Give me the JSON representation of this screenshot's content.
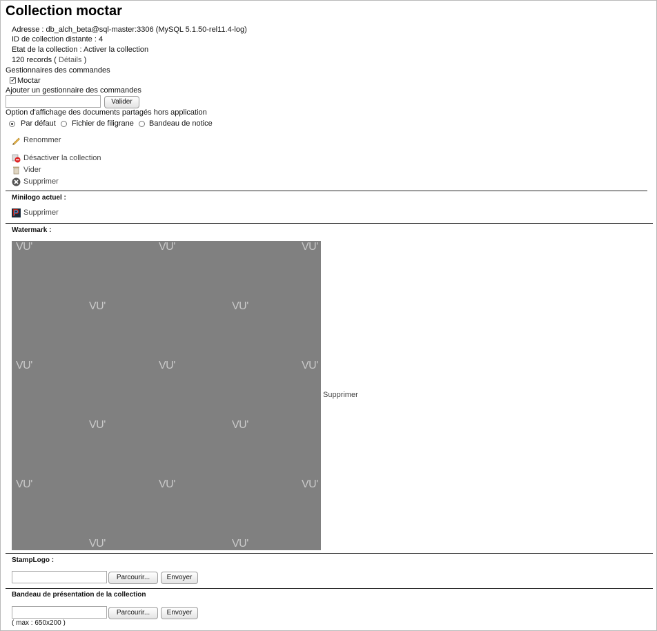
{
  "page": {
    "title": "Collection moctar"
  },
  "info": {
    "adresse": "Adresse : db_alch_beta@sql-master:3306 (MySQL 5.1.50-rel11.4-log)",
    "distant_id": "ID de collection distante : 4",
    "etat": "Etat de la collection : Activer la collection",
    "records_prefix": "120 records (",
    "records_link": "Détails",
    "records_suffix": ")"
  },
  "managers": {
    "heading": "Gestionnaires des commandes",
    "list": [
      {
        "name": "Moctar",
        "checked": true
      }
    ],
    "add_label": "Ajouter un gestionnaire des commandes",
    "add_value": "",
    "submit_label": "Valider"
  },
  "display_option": {
    "heading": "Option d'affichage des documents partagés hors application",
    "options": [
      {
        "label": "Par défaut",
        "selected": true
      },
      {
        "label": "Fichier de filigrane",
        "selected": false
      },
      {
        "label": "Bandeau de notice",
        "selected": false
      }
    ]
  },
  "actions": {
    "rename": "Renommer",
    "deactivate": "Désactiver la collection",
    "empty": "Vider",
    "delete": "Supprimer"
  },
  "minilogo": {
    "heading": "Minilogo actuel :",
    "delete": "Supprimer"
  },
  "watermark": {
    "heading": "Watermark :",
    "tile_text": "VU'",
    "delete": "Supprimer",
    "background": "#808080"
  },
  "stamplogo": {
    "heading": "StampLogo :",
    "file_value": "",
    "browse_label": "Parcourir...",
    "send_label": "Envoyer"
  },
  "banner": {
    "heading": "Bandeau de présentation de la collection",
    "file_value": "",
    "browse_label": "Parcourir...",
    "send_label": "Envoyer",
    "max_note": "( max : 650x200 )"
  }
}
